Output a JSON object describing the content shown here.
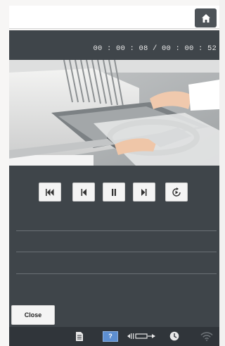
{
  "header": {
    "home_icon": "home-icon"
  },
  "player": {
    "timecode": "00 : 00 : 08 / 00 : 00 : 52",
    "controls": [
      {
        "name": "skip-to-start-button",
        "icon": "skip-to-start-icon"
      },
      {
        "name": "previous-button",
        "icon": "previous-icon"
      },
      {
        "name": "pause-button",
        "icon": "pause-icon"
      },
      {
        "name": "next-button",
        "icon": "next-icon"
      },
      {
        "name": "replay-button",
        "icon": "replay-icon"
      }
    ]
  },
  "close_label": "Close",
  "status_bar": {
    "help_label": "?",
    "icons": [
      "document-icon",
      "help-icon",
      "frame-width-icon",
      "clock-icon",
      "wifi-icon"
    ]
  },
  "colors": {
    "panel": "#3f454a",
    "status_bar": "#30353a",
    "help_accent": "#5d8fd1"
  }
}
